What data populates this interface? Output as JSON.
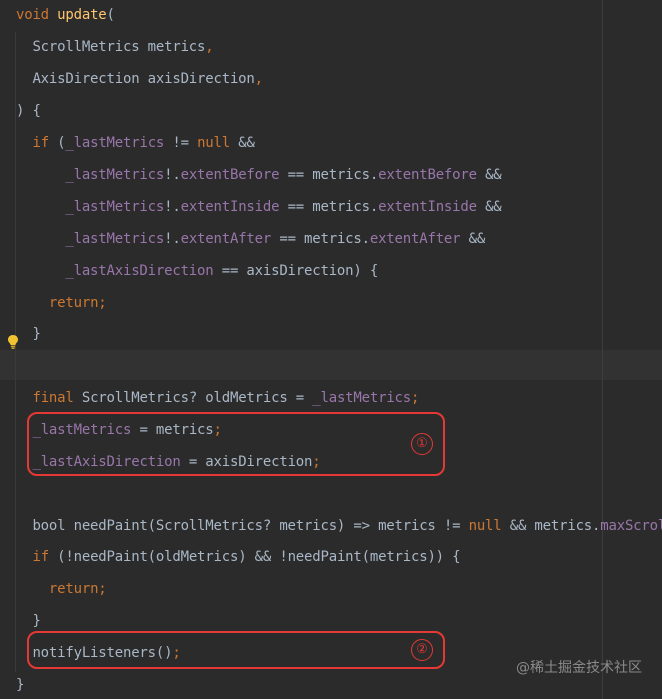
{
  "editor": {
    "lines": [
      [
        {
          "t": "void ",
          "c": "kw"
        },
        {
          "t": "update",
          "c": "fn"
        },
        {
          "t": "(",
          "c": "plain"
        }
      ],
      [
        {
          "t": "  ScrollMetrics metrics",
          "c": "plain"
        },
        {
          "t": ",",
          "c": "kw"
        }
      ],
      [
        {
          "t": "  AxisDirection axisDirection",
          "c": "plain"
        },
        {
          "t": ",",
          "c": "kw"
        }
      ],
      [
        {
          "t": ") {",
          "c": "plain"
        }
      ],
      [
        {
          "t": "  ",
          "c": "plain"
        },
        {
          "t": "if",
          "c": "kw"
        },
        {
          "t": " (",
          "c": "plain"
        },
        {
          "t": "_lastMetrics",
          "c": "fld"
        },
        {
          "t": " != ",
          "c": "plain"
        },
        {
          "t": "null",
          "c": "kw"
        },
        {
          "t": " &&",
          "c": "plain"
        }
      ],
      [
        {
          "t": "      ",
          "c": "plain"
        },
        {
          "t": "_lastMetrics",
          "c": "fld"
        },
        {
          "t": "!.",
          "c": "plain"
        },
        {
          "t": "extentBefore",
          "c": "fld"
        },
        {
          "t": " == metrics.",
          "c": "plain"
        },
        {
          "t": "extentBefore",
          "c": "fld"
        },
        {
          "t": " &&",
          "c": "plain"
        }
      ],
      [
        {
          "t": "      ",
          "c": "plain"
        },
        {
          "t": "_lastMetrics",
          "c": "fld"
        },
        {
          "t": "!.",
          "c": "plain"
        },
        {
          "t": "extentInside",
          "c": "fld"
        },
        {
          "t": " == metrics.",
          "c": "plain"
        },
        {
          "t": "extentInside",
          "c": "fld"
        },
        {
          "t": " &&",
          "c": "plain"
        }
      ],
      [
        {
          "t": "      ",
          "c": "plain"
        },
        {
          "t": "_lastMetrics",
          "c": "fld"
        },
        {
          "t": "!.",
          "c": "plain"
        },
        {
          "t": "extentAfter",
          "c": "fld"
        },
        {
          "t": " == metrics.",
          "c": "plain"
        },
        {
          "t": "extentAfter",
          "c": "fld"
        },
        {
          "t": " &&",
          "c": "plain"
        }
      ],
      [
        {
          "t": "      ",
          "c": "plain"
        },
        {
          "t": "_lastAxisDirection",
          "c": "fld"
        },
        {
          "t": " == axisDirection) {",
          "c": "plain"
        }
      ],
      [
        {
          "t": "    ",
          "c": "plain"
        },
        {
          "t": "return",
          "c": "kw"
        },
        {
          "t": ";",
          "c": "kw"
        }
      ],
      [
        {
          "t": "  }",
          "c": "plain"
        }
      ],
      [],
      [
        {
          "t": "  ",
          "c": "plain"
        },
        {
          "t": "final",
          "c": "kw"
        },
        {
          "t": " ScrollMetrics? oldMetrics = ",
          "c": "plain"
        },
        {
          "t": "_lastMetrics",
          "c": "fld"
        },
        {
          "t": ";",
          "c": "kw"
        }
      ],
      [
        {
          "t": "  ",
          "c": "plain"
        },
        {
          "t": "_lastMetrics",
          "c": "fld"
        },
        {
          "t": " = metrics",
          "c": "plain"
        },
        {
          "t": ";",
          "c": "kw"
        }
      ],
      [
        {
          "t": "  ",
          "c": "plain"
        },
        {
          "t": "_lastAxisDirection",
          "c": "fld"
        },
        {
          "t": " = axisDirection",
          "c": "plain"
        },
        {
          "t": ";",
          "c": "kw"
        }
      ],
      [],
      [
        {
          "t": "  bool needPaint(ScrollMetrics? metrics) => metrics != ",
          "c": "plain"
        },
        {
          "t": "null",
          "c": "kw"
        },
        {
          "t": " && metrics.",
          "c": "plain"
        },
        {
          "t": "maxScrollExtent",
          "c": "fld"
        }
      ],
      [
        {
          "t": "  ",
          "c": "plain"
        },
        {
          "t": "if",
          "c": "kw"
        },
        {
          "t": " (!needPaint(oldMetrics) && !needPaint(metrics)) {",
          "c": "plain"
        }
      ],
      [
        {
          "t": "    ",
          "c": "plain"
        },
        {
          "t": "return",
          "c": "kw"
        },
        {
          "t": ";",
          "c": "kw"
        }
      ],
      [
        {
          "t": "  }",
          "c": "plain"
        }
      ],
      [
        {
          "t": "  notifyListeners()",
          "c": "plain"
        },
        {
          "t": ";",
          "c": "kw"
        }
      ],
      [
        {
          "t": "}",
          "c": "plain"
        }
      ]
    ]
  },
  "annotations": {
    "marker_1": "①",
    "marker_2": "②"
  },
  "watermark": "@稀土掘金技术社区",
  "icons": {
    "gutter_hint": "lightbulb-icon"
  },
  "colors": {
    "background": "#2b2b2b",
    "keyword": "#cc7832",
    "field": "#9876aa",
    "function": "#ffc66d",
    "text": "#a9b7c6",
    "annotation": "#e53935"
  }
}
